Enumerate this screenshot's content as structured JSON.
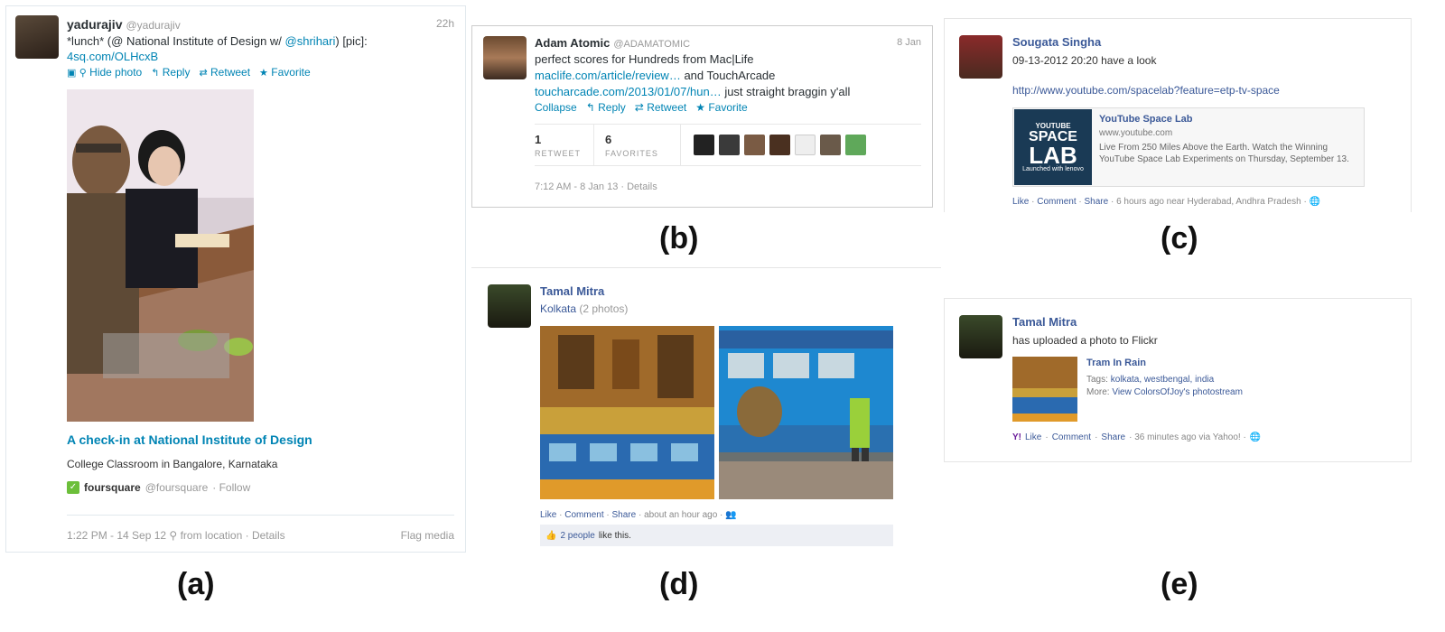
{
  "captions": {
    "a": "(a)",
    "b": "(b)",
    "c": "(c)",
    "d": "(d)",
    "e": "(e)"
  },
  "tweet_a": {
    "name": "yadurajiv",
    "handle": "@yadurajiv",
    "time": "22h",
    "text_1": "*lunch* (@ National Institute of Design w/ ",
    "mention": "@shrihari",
    "text_2": ") [pic]:",
    "link": "4sq.com/OLHcxB",
    "actions": {
      "hide_photo": "Hide photo",
      "reply": "Reply",
      "retweet": "Retweet",
      "favorite": "Favorite"
    },
    "checkin_title": "A check-in at National Institute of Design",
    "checkin_location": "College Classroom in Bangalore, Karnataka",
    "app_name": "foursquare",
    "app_handle": "@foursquare",
    "app_follow": "· Follow",
    "footer": "1:22 PM - 14 Sep 12",
    "from_location": "from location",
    "details": "· Details",
    "flag": "Flag media"
  },
  "tweet_b": {
    "name": "Adam Atomic",
    "handle": "@ADAMATOMIC",
    "time": "8 Jan",
    "line1": "perfect scores for Hundreds from Mac|Life",
    "link1": "maclife.com/article/review…",
    "line2": " and TouchArcade",
    "link2": "toucharcade.com/2013/01/07/hun…",
    "line3": " just straight braggin y'all",
    "actions": {
      "collapse": "Collapse",
      "reply": "Reply",
      "retweet": "Retweet",
      "favorite": "Favorite"
    },
    "retweets_count": "1",
    "retweets_label": "RETWEET",
    "favorites_count": "6",
    "favorites_label": "FAVORITES",
    "footer": "7:12 AM - 8 Jan 13 · Details"
  },
  "post_c": {
    "name": "Sougata Singha",
    "message": "09-13-2012 20:20 have a look",
    "url": "http://www.youtube.com/spacelab?feature=etp-tv-space",
    "card_title": "YouTube Space Lab",
    "card_domain": "www.youtube.com",
    "card_desc": "Live From 250 Miles Above the Earth. Watch the Winning YouTube Space Lab Experiments on Thursday, September 13.",
    "thumb_line1": "YOUTUBE",
    "thumb_line2": "SPACE",
    "thumb_line3": "LAB",
    "thumb_line4": "Launched with lenovo",
    "like": "Like",
    "comment": "Comment",
    "share": "Share",
    "meta": "· 6 hours ago near Hyderabad, Andhra Pradesh ·"
  },
  "post_d": {
    "name": "Tamal Mitra",
    "album": "Kolkata",
    "count": "(2 photos)",
    "like": "Like",
    "comment": "Comment",
    "share": "Share",
    "meta": "· about an hour ago ·",
    "likes_people": "2 people",
    "likes_suffix": "like this."
  },
  "post_e": {
    "name": "Tamal Mitra",
    "message": "has uploaded a photo to Flickr",
    "photo_title": "Tram In Rain",
    "tags_label": "Tags:",
    "tags": "kolkata, westbengal, india",
    "more_label": "More:",
    "more_link": "View ColorsOfJoy's photostream",
    "like": "Like",
    "comment": "Comment",
    "share": "Share",
    "meta": "· 36 minutes ago via Yahoo! ·"
  }
}
